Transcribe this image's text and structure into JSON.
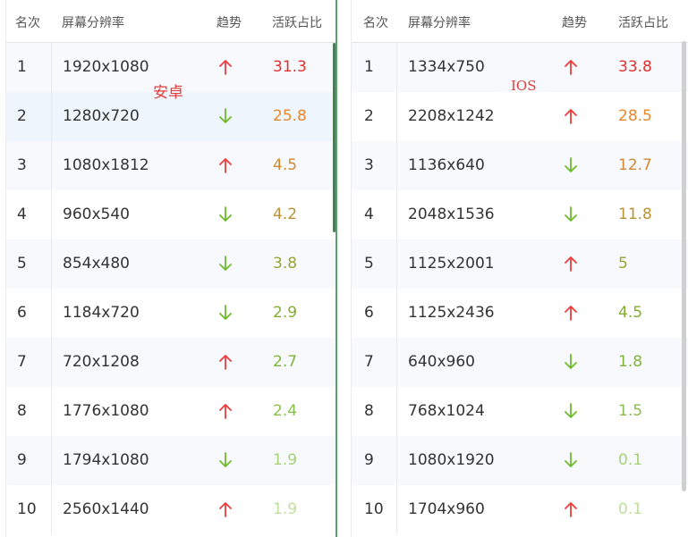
{
  "colors": {
    "up": "#ee3b3b",
    "down": "#6dbb2a"
  },
  "left": {
    "overlay_label": "安卓",
    "headers": [
      "名次",
      "屏幕分辨率",
      "趋势",
      "活跃占比"
    ],
    "rows": [
      {
        "rank": "1",
        "resolution": "1920x1080",
        "trend": "up",
        "share": "31.3",
        "share_color": "#e03131"
      },
      {
        "rank": "2",
        "resolution": "1280x720",
        "trend": "down",
        "share": "25.8",
        "share_color": "#e8862e"
      },
      {
        "rank": "3",
        "resolution": "1080x1812",
        "trend": "up",
        "share": "4.5",
        "share_color": "#d08a33"
      },
      {
        "rank": "4",
        "resolution": "960x540",
        "trend": "down",
        "share": "4.2",
        "share_color": "#b99235"
      },
      {
        "rank": "5",
        "resolution": "854x480",
        "trend": "down",
        "share": "3.8",
        "share_color": "#9ba42f"
      },
      {
        "rank": "6",
        "resolution": "1184x720",
        "trend": "down",
        "share": "2.9",
        "share_color": "#82ad2f"
      },
      {
        "rank": "7",
        "resolution": "720x1208",
        "trend": "up",
        "share": "2.7",
        "share_color": "#7fb43a"
      },
      {
        "rank": "8",
        "resolution": "1776x1080",
        "trend": "up",
        "share": "2.4",
        "share_color": "#88be4c"
      },
      {
        "rank": "9",
        "resolution": "1794x1080",
        "trend": "down",
        "share": "1.9",
        "share_color": "#a5d275"
      },
      {
        "rank": "10",
        "resolution": "2560x1440",
        "trend": "up",
        "share": "1.9",
        "share_color": "#bfe09b"
      }
    ]
  },
  "right": {
    "overlay_label": "IOS",
    "headers": [
      "名次",
      "屏幕分辨率",
      "趋势",
      "活跃占比"
    ],
    "rows": [
      {
        "rank": "1",
        "resolution": "1334x750",
        "trend": "up",
        "share": "33.8",
        "share_color": "#e03131"
      },
      {
        "rank": "2",
        "resolution": "2208x1242",
        "trend": "up",
        "share": "28.5",
        "share_color": "#e8862e"
      },
      {
        "rank": "3",
        "resolution": "1136x640",
        "trend": "down",
        "share": "12.7",
        "share_color": "#d08a33"
      },
      {
        "rank": "4",
        "resolution": "2048x1536",
        "trend": "down",
        "share": "11.8",
        "share_color": "#b99235"
      },
      {
        "rank": "5",
        "resolution": "1125x2001",
        "trend": "up",
        "share": "5",
        "share_color": "#9ba42f"
      },
      {
        "rank": "6",
        "resolution": "1125x2436",
        "trend": "up",
        "share": "4.5",
        "share_color": "#82ad2f"
      },
      {
        "rank": "7",
        "resolution": "640x960",
        "trend": "down",
        "share": "1.8",
        "share_color": "#7fb43a"
      },
      {
        "rank": "8",
        "resolution": "768x1024",
        "trend": "down",
        "share": "1.5",
        "share_color": "#88be4c"
      },
      {
        "rank": "9",
        "resolution": "1080x1920",
        "trend": "down",
        "share": "0.1",
        "share_color": "#a5d275"
      },
      {
        "rank": "10",
        "resolution": "1704x960",
        "trend": "up",
        "share": "0.1",
        "share_color": "#bfe09b"
      }
    ]
  }
}
